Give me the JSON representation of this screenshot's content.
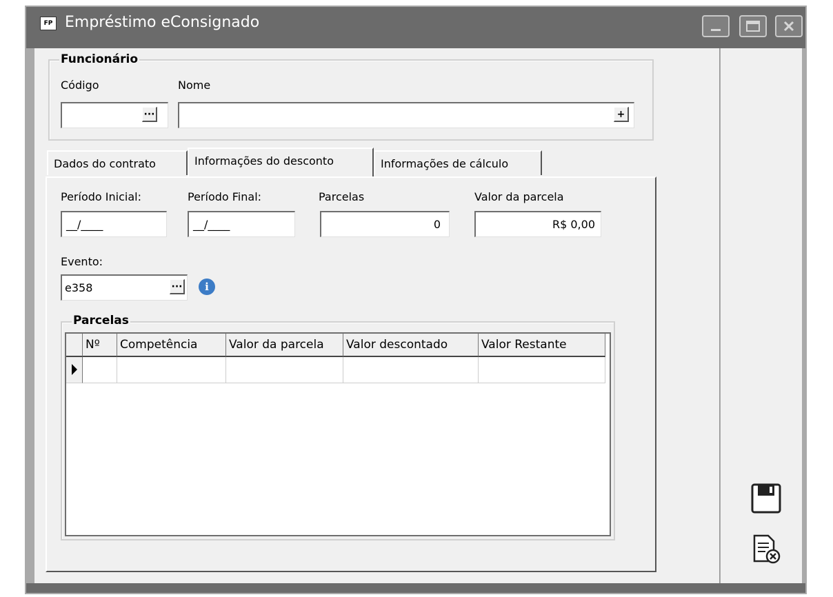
{
  "window": {
    "title": "Empréstimo eConsignado",
    "app_icon": "FP"
  },
  "funcionario": {
    "group_label": "Funcionário",
    "codigo_label": "Código",
    "nome_label": "Nome",
    "codigo_value": "",
    "nome_value": ""
  },
  "tabs": [
    {
      "label": "Dados do contrato"
    },
    {
      "label": "Informações do desconto"
    },
    {
      "label": "Informações de cálculo"
    }
  ],
  "desconto": {
    "periodo_inicial_label": "Período Inicial:",
    "periodo_inicial_value": "__/____",
    "periodo_final_label": "Período Final:",
    "periodo_final_value": "__/____",
    "parcelas_label": "Parcelas",
    "parcelas_value": "0",
    "valor_parcela_label": "Valor da parcela",
    "valor_parcela_value": "R$ 0,00",
    "evento_label": "Evento:",
    "evento_value": "e358"
  },
  "parcelas_group": {
    "label": "Parcelas",
    "columns": [
      "Nº",
      "Competência",
      "Valor da parcela",
      "Valor descontado",
      "Valor Restante"
    ]
  },
  "icons": {
    "lookup": "ellipsis-icon",
    "add": "plus-icon",
    "info": "info-icon",
    "save": "save-icon",
    "cancel": "cancel-document-icon"
  },
  "colors": {
    "titlebar": "#6b6b6b",
    "info_icon": "#3c7cc6",
    "background": "#f0f0f0"
  }
}
